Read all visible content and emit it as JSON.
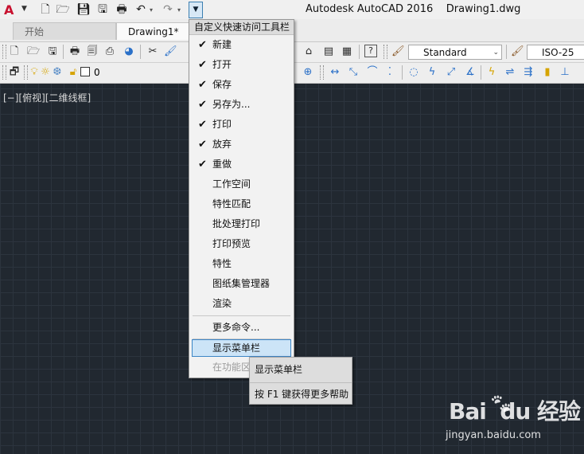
{
  "window": {
    "title": "Autodesk AutoCAD 2016    Drawing1.dwg",
    "app_logo_letter": "A"
  },
  "quick_access_toolbar": {
    "icons": [
      "new-icon",
      "open-icon",
      "save-icon",
      "save-as-icon",
      "plot-icon",
      "undo-icon",
      "redo-icon"
    ],
    "customize_glyph": "▼"
  },
  "tabs": [
    {
      "label": "开始",
      "active": false
    },
    {
      "label": "Drawing1*",
      "active": true
    }
  ],
  "toolbar": {
    "text_style_value": "Standard",
    "dim_style_value": "ISO-25",
    "layer_value": "0"
  },
  "viewport": {
    "label": "[−][俯视][二维线框]"
  },
  "qat_menu": {
    "header": "自定义快速访问工具栏",
    "items": [
      {
        "label": "新建",
        "checked": true
      },
      {
        "label": "打开",
        "checked": true
      },
      {
        "label": "保存",
        "checked": true
      },
      {
        "label": "另存为...",
        "checked": true
      },
      {
        "label": "打印",
        "checked": true
      },
      {
        "label": "放弃",
        "checked": true
      },
      {
        "label": "重做",
        "checked": true
      },
      {
        "label": "工作空间",
        "checked": false
      },
      {
        "label": "特性匹配",
        "checked": false
      },
      {
        "label": "批处理打印",
        "checked": false
      },
      {
        "label": "打印预览",
        "checked": false
      },
      {
        "label": "特性",
        "checked": false
      },
      {
        "label": "图纸集管理器",
        "checked": false
      },
      {
        "label": "渲染",
        "checked": false
      }
    ],
    "more_commands": "更多命令...",
    "show_menu_bar": "显示菜单栏",
    "below_ribbon": "在功能区"
  },
  "tooltip": {
    "title": "显示菜单栏",
    "help": "按 F1 键获得更多帮助"
  },
  "watermark": {
    "logo": "Bai  du 经验",
    "url": "jingyan.baidu.com"
  },
  "colors": {
    "canvas_bg": "#212830",
    "grid_line": "#2c343e",
    "highlight": "#cce4f7",
    "highlight_border": "#3d86c6",
    "app_logo": "#c8102e"
  }
}
